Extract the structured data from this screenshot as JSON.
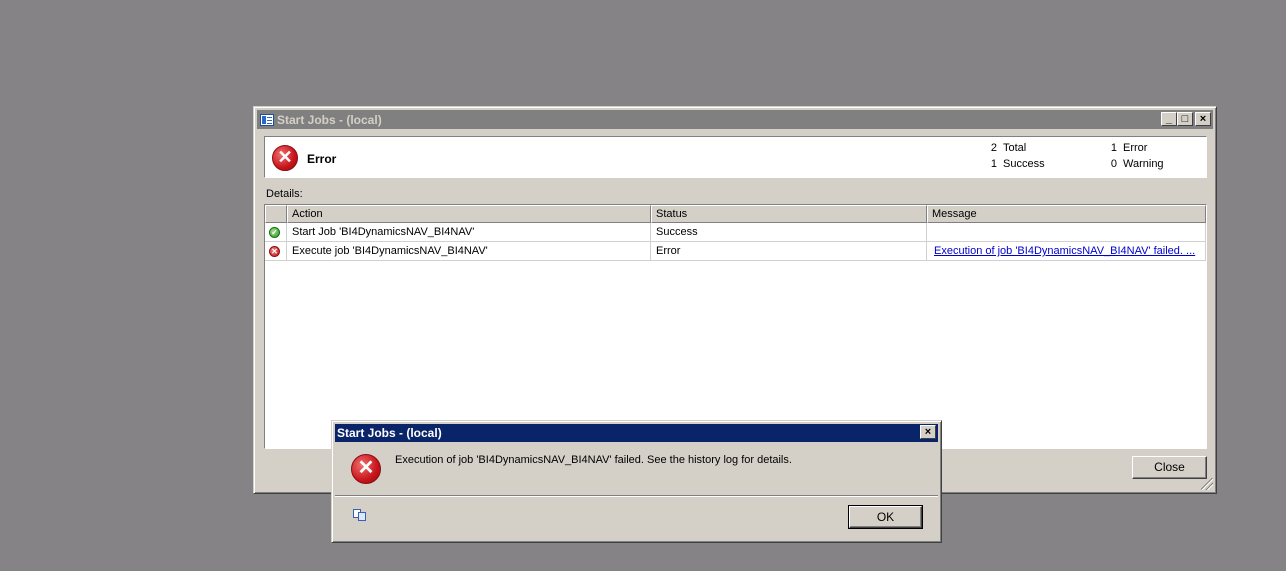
{
  "main_window": {
    "title": "Start Jobs - (local)",
    "title_buttons": {
      "minimize": "_",
      "maximize": "□",
      "close": "×"
    },
    "summary": {
      "status_label": "Error",
      "status_icon": "error-icon",
      "stats": {
        "total": {
          "count": "2",
          "label": "Total"
        },
        "success": {
          "count": "1",
          "label": "Success"
        },
        "error": {
          "count": "1",
          "label": "Error"
        },
        "warning": {
          "count": "0",
          "label": "Warning"
        }
      }
    },
    "details_label": "Details:",
    "table": {
      "columns": [
        "Action",
        "Status",
        "Message"
      ],
      "rows": [
        {
          "icon": "success-icon",
          "action": "Start Job 'BI4DynamicsNAV_BI4NAV'",
          "status": "Success",
          "message": ""
        },
        {
          "icon": "error-icon",
          "action": "Execute job 'BI4DynamicsNAV_BI4NAV'",
          "status": "Error",
          "message": "Execution of job 'BI4DynamicsNAV_BI4NAV' failed. ..."
        }
      ]
    },
    "close_button": "Close"
  },
  "message_box": {
    "title": "Start Jobs - (local)",
    "close_glyph": "×",
    "icon": "error-icon",
    "message": "Execution of job 'BI4DynamicsNAV_BI4NAV' failed.  See the history log for details.",
    "copy_icon": "copy-icon",
    "ok_button": "OK"
  },
  "colors": {
    "desktop": "#858386",
    "window_face": "#d4d0c8",
    "inactive_title": "#808080",
    "active_title": "#0a246a",
    "error_red": "#c8141a",
    "success_green": "#2f9a20",
    "link": "#0000cc"
  }
}
